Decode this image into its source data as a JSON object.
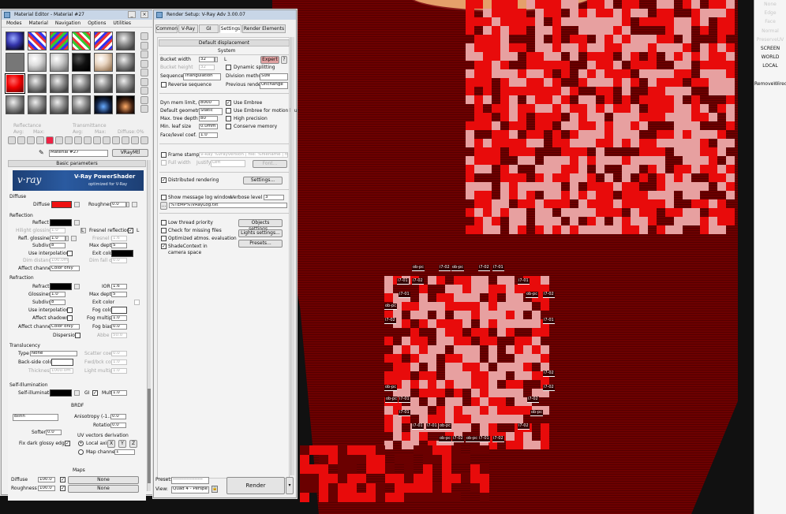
{
  "right_panel": {
    "items": [
      {
        "label": "None",
        "enabled": false
      },
      {
        "label": "Edge",
        "enabled": false
      },
      {
        "label": "Face",
        "enabled": false
      },
      {
        "label": "Normal",
        "enabled": false
      },
      {
        "label": "PreserveUV",
        "enabled": false
      },
      {
        "label": "SCREEN",
        "enabled": true
      },
      {
        "label": "WORLD",
        "enabled": true
      },
      {
        "label": "LOCAL",
        "enabled": true
      },
      {
        "label": "",
        "enabled": true
      },
      {
        "label": "RemoveWired",
        "enabled": true
      }
    ]
  },
  "viewport": {
    "uv_tags": [
      "i7-01",
      "ob-pc",
      "i7-02",
      "ob-pc",
      "i7-02",
      "i7-01",
      "i7-02",
      "ob-pc",
      "i7-01",
      "ob-pc",
      "i7-02",
      "i7-01",
      "i7-01",
      "i7-02",
      "ob-pc",
      "i7-02",
      "i7-01",
      "ob-pc",
      "i7-02",
      "i7-01",
      "ob-pc",
      "i7-02",
      "i7-01",
      "i7-01",
      "ob-pc",
      "i7-02",
      "ob-pc",
      "i7-01",
      "i7-02",
      "ob-pc",
      "i7-02"
    ]
  },
  "material_editor": {
    "title": "Material Editor - Material #27",
    "menus": [
      "Modes",
      "Material",
      "Navigation",
      "Options",
      "Utilities"
    ],
    "reflectance_label": "Reflectance",
    "reflectance_vals": [
      "Avg:",
      "Max:"
    ],
    "transmittance_label": "Transmittance",
    "transmittance_vals": [
      "Avg:",
      "Max:"
    ],
    "diffuse_stat": "Diffuse:",
    "diffuse_pct": "0%",
    "material_name": "Material #27",
    "material_type": "VRayMtl",
    "basic_params": "Basic parameters",
    "banner_logo": "v·ray",
    "banner_title": "V-Ray PowerShader",
    "banner_sub": "optimized for V-Ray",
    "sections": {
      "diffuse": "Diffuse",
      "reflection": "Reflection",
      "refraction": "Refraction",
      "translucency": "Translucency",
      "self_illum": "Self-Illumination",
      "brdf": "BRDF",
      "maps": "Maps"
    },
    "diffuse": {
      "diffuse_label": "Diffuse",
      "diffuse_color": "#ee1111",
      "roughness_label": "Roughness",
      "roughness": "0.0"
    },
    "reflection": {
      "reflect": "Reflect",
      "hilight": "Hilight glossiness",
      "hilight_val": "1.0",
      "l": "L",
      "fresnel": "Fresnel reflections",
      "fresnel_l": "L",
      "refl_gloss": "Refl. glossiness",
      "refl_gloss_val": "1.0",
      "fresnel_ior": "Fresnel IOR",
      "fresnel_ior_val": "1.6",
      "subdivs": "Subdivs",
      "subdivs_val": "8",
      "max_depth": "Max depth",
      "max_depth_val": "5",
      "use_interp": "Use interpolation",
      "exit_color": "Exit color",
      "dim_dist": "Dim distance",
      "dim_dist_val": "100.0m",
      "dim_falloff": "Dim fall off",
      "dim_falloff_val": "0.0",
      "affect_ch": "Affect channels",
      "affect_ch_val": "Color only"
    },
    "refraction": {
      "refract": "Refract",
      "ior": "IOR",
      "ior_val": "1.6",
      "glossiness": "Glossiness",
      "glossiness_val": "1.0",
      "max_depth": "Max depth",
      "max_depth_val": "5",
      "subdivs": "Subdivs",
      "subdivs_val": "8",
      "exit_color": "Exit color",
      "use_interp": "Use interpolation",
      "fog_color": "Fog color",
      "affect_shadows": "Affect shadows",
      "fog_mult": "Fog multiplier",
      "fog_mult_val": "1.0",
      "affect_ch": "Affect channels",
      "affect_ch_val": "Color only",
      "fog_bias": "Fog bias",
      "fog_bias_val": "0.0",
      "dispersion": "Dispersion",
      "abbe": "Abbe",
      "abbe_val": "50.0"
    },
    "translucency": {
      "type": "Type",
      "type_val": "None",
      "scatter": "Scatter coeff",
      "scatter_val": "0.0",
      "backside": "Back-side color",
      "fwd_bck": "Fwd/bck coeff",
      "fwd_bck_val": "1.0",
      "thickness": "Thickness",
      "thickness_val": "1000.0m",
      "light_mult": "Light multiplier",
      "light_mult_val": "1.0"
    },
    "self_illum": {
      "label": "Self-illumination",
      "gi": "GI",
      "mult": "Mult",
      "mult_val": "1.0"
    },
    "brdf": {
      "type_val": "Blinn",
      "anisotropy": "Anisotropy (-1..1)",
      "anisotropy_val": "0.0",
      "rotation": "Rotation",
      "rotation_val": "0.0",
      "soften": "Soften",
      "soften_val": "0.0",
      "uv_deriv": "UV vectors derivation",
      "local_axis": "Local axis",
      "x": "X",
      "y": "Y",
      "z": "Z",
      "map_channel": "Map channel",
      "map_channel_val": "1",
      "fix_dark": "Fix dark glossy edges"
    },
    "maps": [
      {
        "name": "Diffuse",
        "amount": "100.0",
        "map": "None"
      },
      {
        "name": "Roughness",
        "amount": "100.0",
        "map": "None"
      }
    ]
  },
  "render_setup": {
    "title": "Render Setup: V-Ray Adv 3.00.07",
    "tabs": [
      "Common",
      "V-Ray",
      "GI",
      "Settings",
      "Render Elements"
    ],
    "active_tab": 3,
    "default_disp": "Default displacement",
    "system": "System",
    "bucket_width": "Bucket width",
    "bucket_width_val": "32",
    "bucket_l": "L",
    "expert": "Expert",
    "help": "?",
    "bucket_height": "Bucket height",
    "bucket_height_val": "32",
    "dynamic_split": "Dynamic splitting",
    "sequence": "Sequence",
    "sequence_val": "Triangulation",
    "division": "Division method",
    "division_val": "Size",
    "reverse": "Reverse sequence",
    "prev_render": "Previous render",
    "prev_render_val": "Unchange",
    "dyn_mem": "Dyn mem limit, mb",
    "dyn_mem_val": "8000",
    "use_embree": "Use Embree",
    "def_geom": "Default geometry",
    "def_geom_val": "Static",
    "embree_blur": "Use Embree for motion blur",
    "tree_depth": "Max. tree depth",
    "tree_depth_val": "80",
    "high_prec": "High precision",
    "leaf_size": "Min. leaf size",
    "leaf_size_val": "0.0mm",
    "conserve": "Conserve memory",
    "face_level": "Face/level coef.",
    "face_level_val": "1.0",
    "frame_stamp": "Frame stamp",
    "frame_stamp_val": "V-Ray %vrayversion | file: %filename | frame",
    "full_width": "Full width",
    "justify": "Justify",
    "justify_val": "Left",
    "font": "Font...",
    "distributed": "Distributed rendering",
    "dist_settings": "Settings...",
    "show_log": "Show message log window",
    "verbose": "Verbose level",
    "verbose_val": "3",
    "log_browse": "...",
    "log_path": "%TEMP%\\VRayLog.txt",
    "low_thread": "Low thread priority",
    "objects": "Objects settings...",
    "missing": "Check for missing files",
    "lights": "Lights settings...",
    "optimized": "Optimized atmos. evaluation",
    "presets_btn": "Presets...",
    "shade_ctx": "ShadeContext in camera space",
    "preset": "Preset:",
    "preset_val": "-------------------",
    "view": "View:",
    "view_val": "Quad 4 - Perspe",
    "render": "Render"
  }
}
